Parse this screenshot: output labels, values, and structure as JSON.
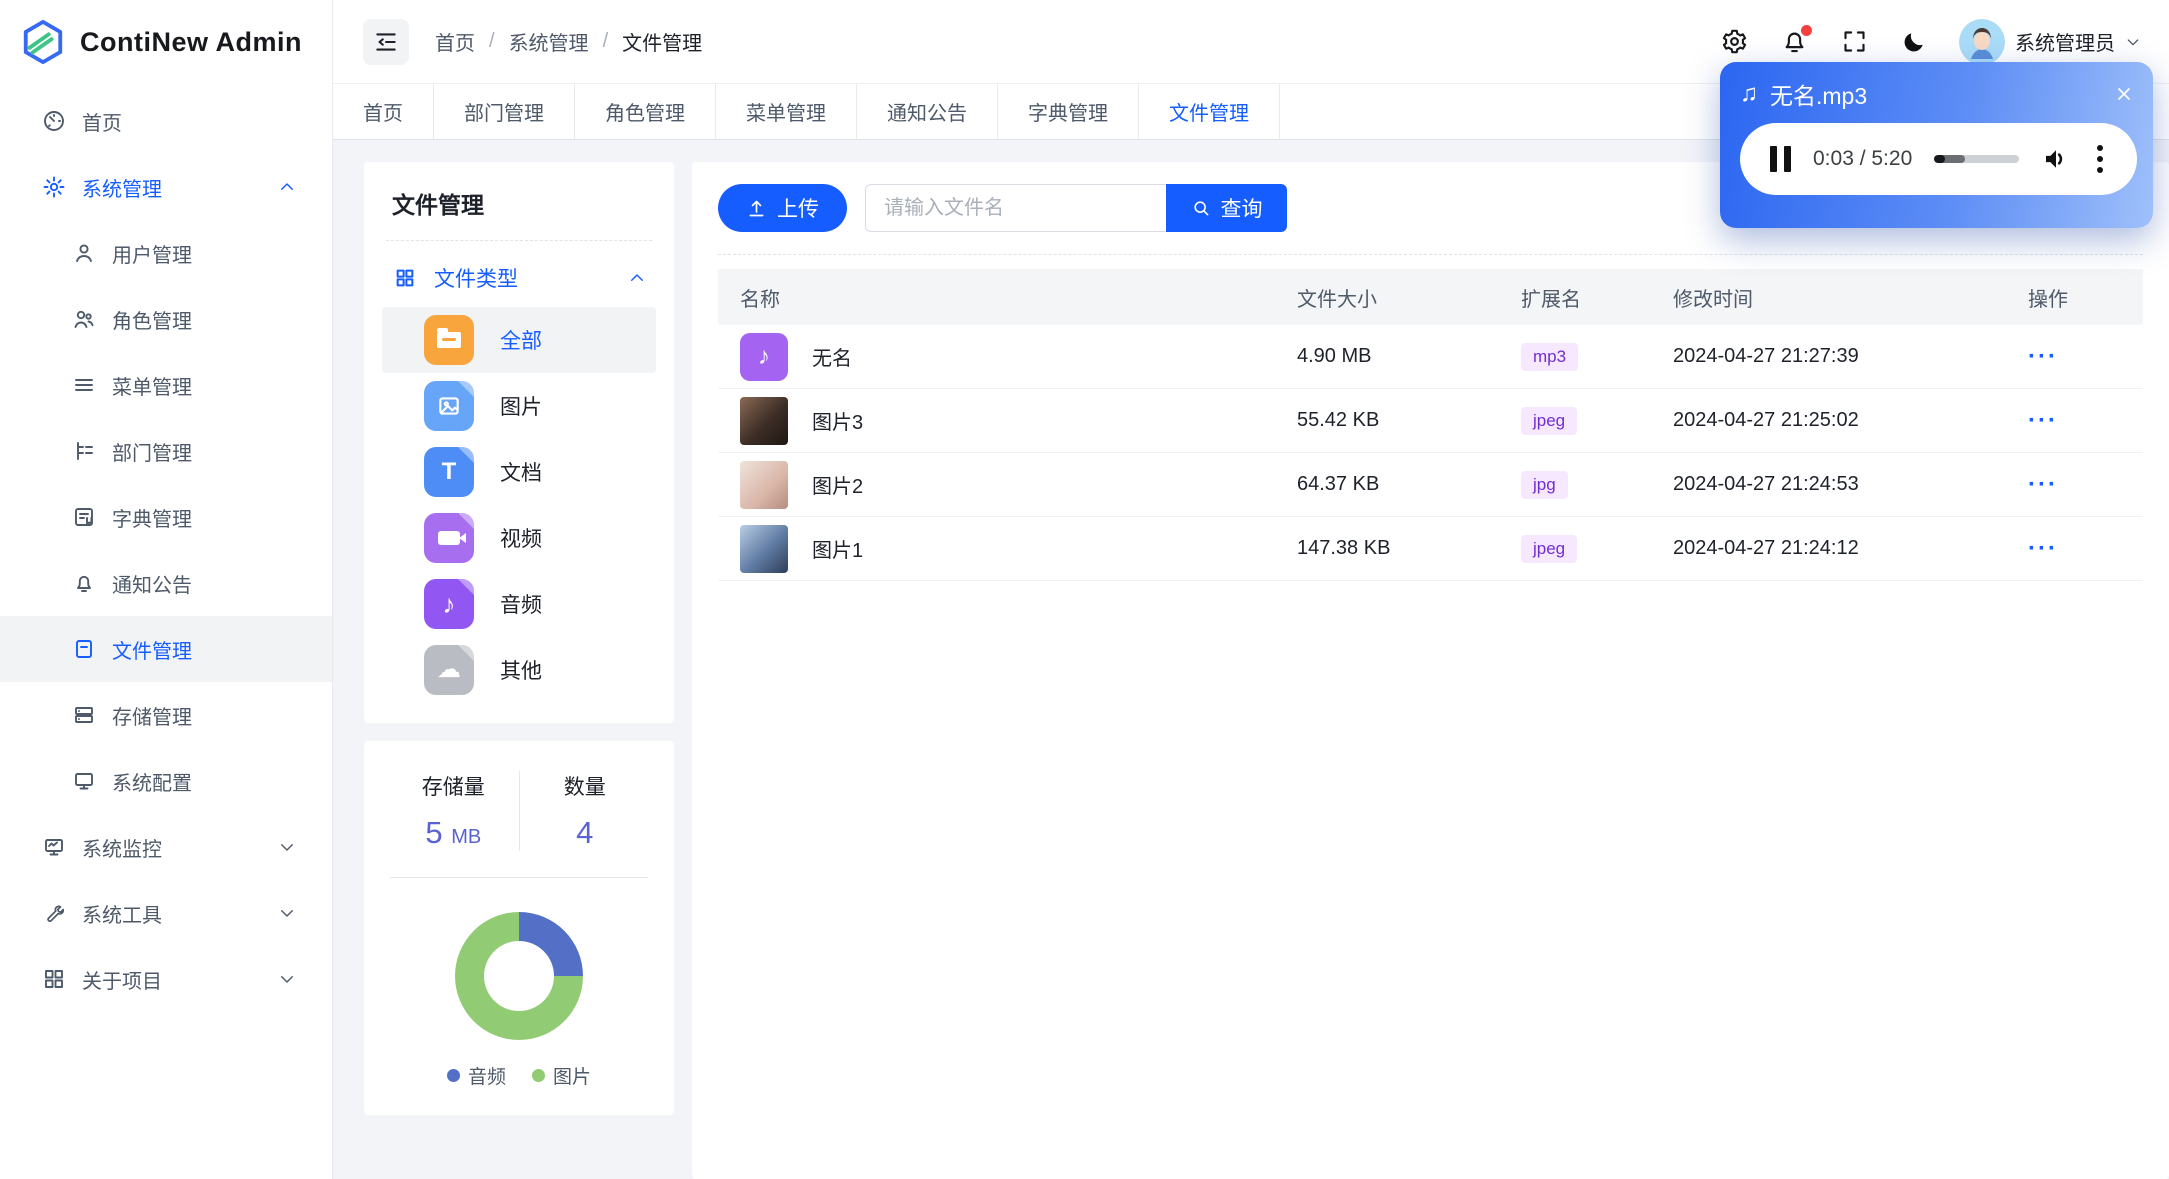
{
  "app": {
    "name": "ContiNew Admin"
  },
  "topbar": {
    "breadcrumb": [
      "首页",
      "系统管理",
      "文件管理"
    ],
    "separator": "/",
    "username": "系统管理员"
  },
  "tabs": [
    {
      "label": "首页"
    },
    {
      "label": "部门管理"
    },
    {
      "label": "角色管理"
    },
    {
      "label": "菜单管理"
    },
    {
      "label": "通知公告"
    },
    {
      "label": "字典管理"
    },
    {
      "label": "文件管理",
      "active": true
    }
  ],
  "sidebar": {
    "items": [
      {
        "label": "首页"
      },
      {
        "label": "系统管理"
      },
      {
        "label": "用户管理"
      },
      {
        "label": "角色管理"
      },
      {
        "label": "菜单管理"
      },
      {
        "label": "部门管理"
      },
      {
        "label": "字典管理"
      },
      {
        "label": "通知公告"
      },
      {
        "label": "文件管理"
      },
      {
        "label": "存储管理"
      },
      {
        "label": "系统配置"
      },
      {
        "label": "系统监控"
      },
      {
        "label": "系统工具"
      },
      {
        "label": "关于项目"
      }
    ]
  },
  "file_panel": {
    "title": "文件管理",
    "group_label": "文件类型",
    "types": [
      {
        "label": "全部",
        "selected": true
      },
      {
        "label": "图片"
      },
      {
        "label": "文档"
      },
      {
        "label": "视频"
      },
      {
        "label": "音频"
      },
      {
        "label": "其他"
      }
    ]
  },
  "storage_panel": {
    "stats": [
      {
        "label": "存储量",
        "value": "5",
        "unit": "MB"
      },
      {
        "label": "数量",
        "value": "4",
        "unit": ""
      }
    ]
  },
  "chart_data": {
    "type": "pie",
    "title": "",
    "labels": [
      "音频",
      "图片"
    ],
    "values": [
      1,
      3
    ],
    "percents": [
      25,
      75
    ],
    "colors": [
      "#5470C6",
      "#91CC75"
    ],
    "donut": true,
    "legend_position": "bottom"
  },
  "toolbar": {
    "upload_label": "上传",
    "search_placeholder": "请输入文件名",
    "query_label": "查询"
  },
  "table": {
    "headers": [
      "名称",
      "文件大小",
      "扩展名",
      "修改时间",
      "操作"
    ],
    "actions_glyph": "···",
    "rows": [
      {
        "name": "无名",
        "size": "4.90 MB",
        "ext": "mp3",
        "time": "2024-04-27 21:27:39"
      },
      {
        "name": "图片3",
        "size": "55.42 KB",
        "ext": "jpeg",
        "time": "2024-04-27 21:25:02"
      },
      {
        "name": "图片2",
        "size": "64.37 KB",
        "ext": "jpg",
        "time": "2024-04-27 21:24:53"
      },
      {
        "name": "图片1",
        "size": "147.38 KB",
        "ext": "jpeg",
        "time": "2024-04-27 21:24:12"
      }
    ]
  },
  "player": {
    "filename": "无名.mp3",
    "time": "0:03 / 5:20",
    "progress_pct": 13,
    "buffer_pct": 36,
    "note_glyph": "♫",
    "table_note_glyph": "♪"
  },
  "colors": {
    "accent": "#165DFF",
    "badge_text": "#722ED1",
    "badge_bg": "#F5E8FF",
    "pie_audio": "#5470C6",
    "pie_image": "#91CC75",
    "stat_value": "#5A62D2",
    "notice_dot": "#F53F3F"
  }
}
